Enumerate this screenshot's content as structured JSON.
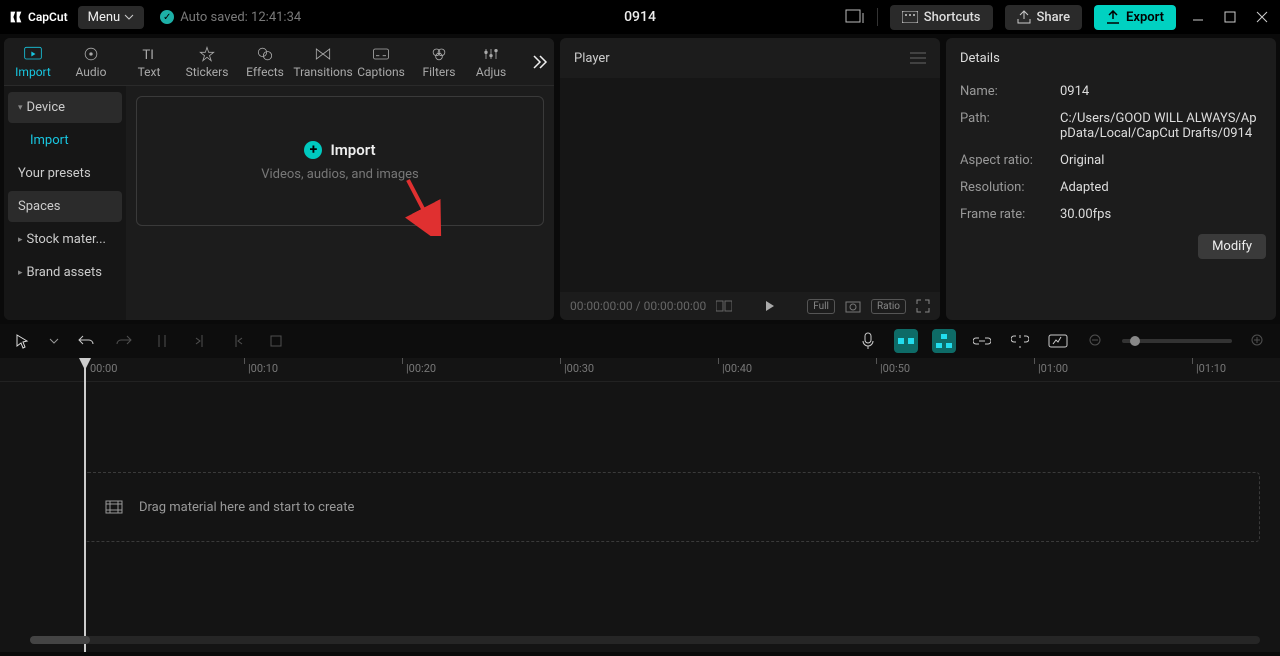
{
  "title": "0914",
  "menu_label": "Menu",
  "autosave": "Auto saved: 12:41:34",
  "top_buttons": {
    "shortcuts": "Shortcuts",
    "share": "Share",
    "export": "Export"
  },
  "media_tabs": [
    "Import",
    "Audio",
    "Text",
    "Stickers",
    "Effects",
    "Transitions",
    "Captions",
    "Filters",
    "Adjus"
  ],
  "side_items": {
    "device": "Device",
    "import": "Import",
    "presets": "Your presets",
    "spaces": "Spaces",
    "stock": "Stock mater...",
    "brand": "Brand assets"
  },
  "dropzone": {
    "title": "Import",
    "sub": "Videos, audios, and images"
  },
  "player": {
    "title": "Player",
    "time": "00:00:00:00 / 00:00:00:00",
    "full": "Full",
    "ratio": "Ratio"
  },
  "details": {
    "hdr": "Details",
    "name_k": "Name:",
    "name_v": "0914",
    "path_k": "Path:",
    "path_v": "C:/Users/GOOD WILL ALWAYS/AppData/Local/CapCut Drafts/0914",
    "ar_k": "Aspect ratio:",
    "ar_v": "Original",
    "res_k": "Resolution:",
    "res_v": "Adapted",
    "fr_k": "Frame rate:",
    "fr_v": "30.00fps",
    "modify": "Modify"
  },
  "ruler": [
    "00:00",
    "|00:10",
    "|00:20",
    "|00:30",
    "|00:40",
    "|00:50",
    "|01:00",
    "|01:10"
  ],
  "track_hint": "Drag material here and start to create"
}
